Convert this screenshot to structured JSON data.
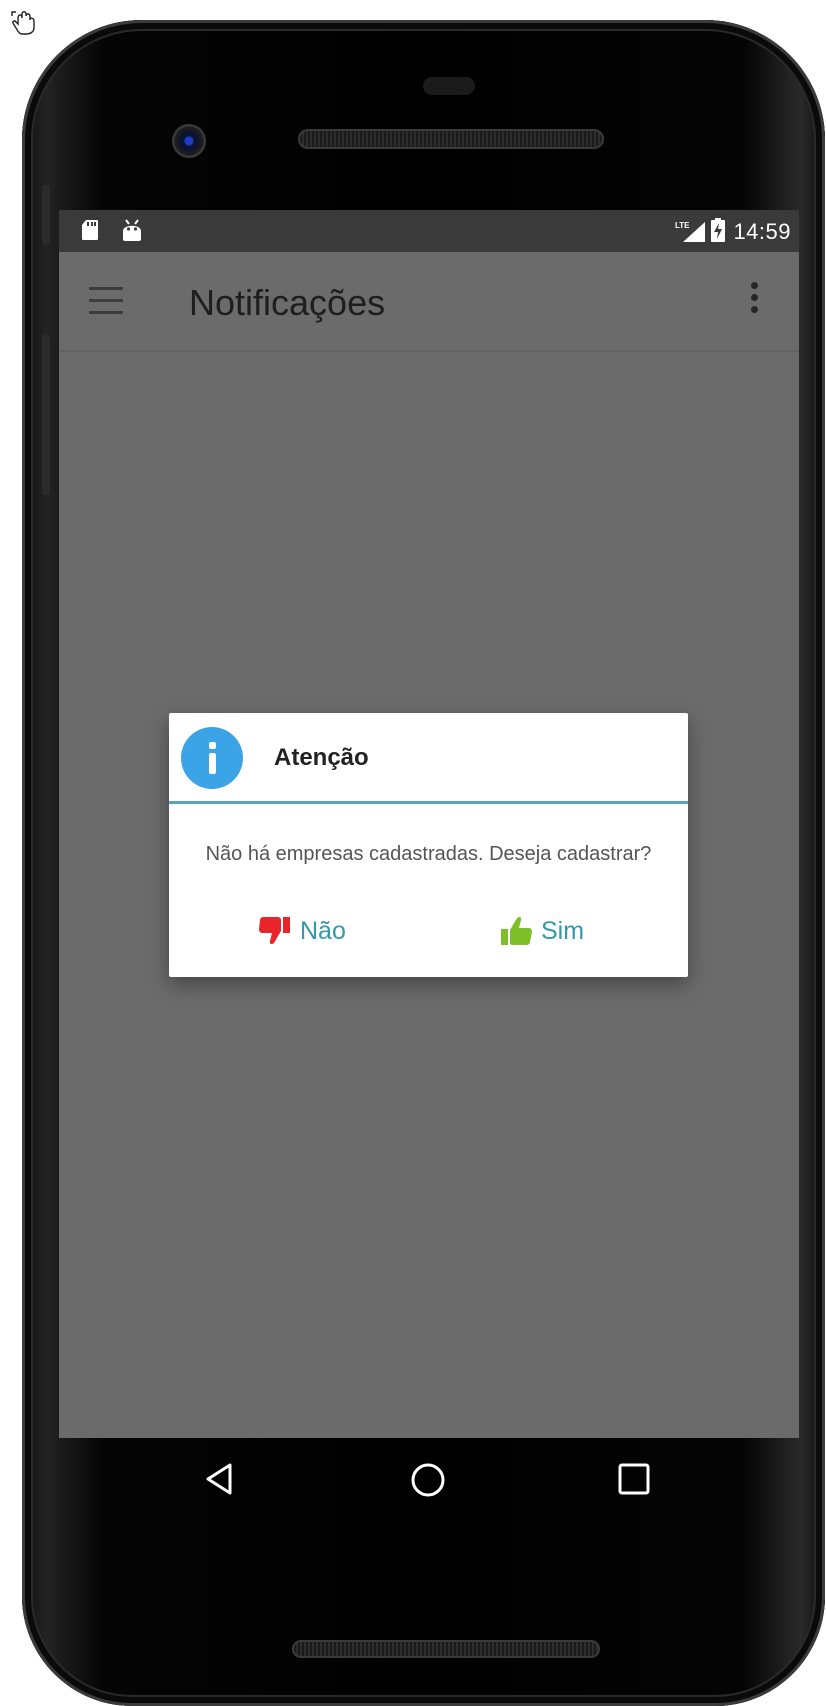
{
  "status_bar": {
    "time": "14:59",
    "left_icons": [
      "sd-card-icon",
      "android-debug-icon"
    ],
    "right_icons": [
      "lte-signal-icon",
      "battery-charging-icon"
    ]
  },
  "app_bar": {
    "title": "Notificações",
    "menu_icon": "hamburger-menu-icon",
    "overflow_icon": "more-vert-icon"
  },
  "dialog": {
    "icon": "info-icon",
    "title": "Atenção",
    "message": "Não há empresas cadastradas. Deseja cadastrar?",
    "buttons": {
      "no": {
        "label": "Não",
        "icon": "thumbs-down-icon",
        "icon_color": "#e8252a"
      },
      "yes": {
        "label": "Sim",
        "icon": "thumbs-up-icon",
        "icon_color": "#7fbf2a"
      }
    },
    "accent_color": "#5aa5b3",
    "button_text_color": "#3399aa"
  },
  "nav_bar": {
    "buttons": [
      "back-icon",
      "home-icon",
      "recents-icon"
    ]
  },
  "colors": {
    "screen_background": "#6b6b6b",
    "status_bar": "#3a3a3a",
    "info_icon": "#3aa4e6"
  }
}
